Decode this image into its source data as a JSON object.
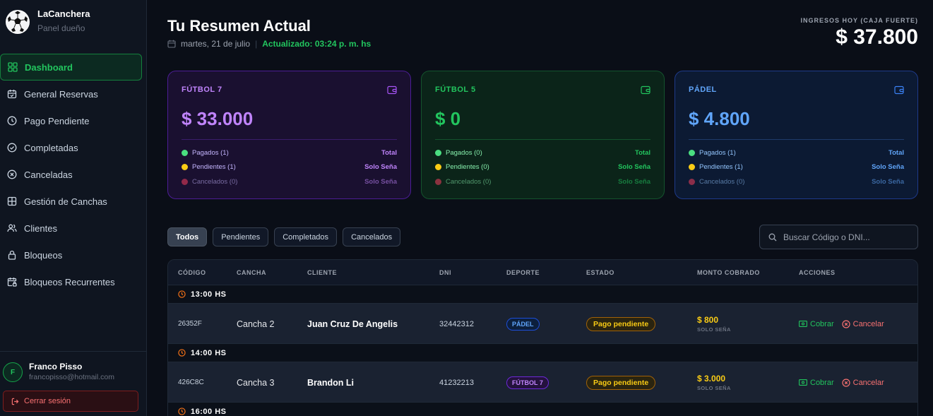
{
  "brand": {
    "name": "LaCanchera",
    "subtitle": "Panel dueño"
  },
  "sidebar": {
    "items": [
      {
        "label": "Dashboard",
        "icon": "grid-icon",
        "active": true
      },
      {
        "label": "General Reservas",
        "icon": "calendar-icon"
      },
      {
        "label": "Pago Pendiente",
        "icon": "clock-icon"
      },
      {
        "label": "Completadas",
        "icon": "check-circle-icon"
      },
      {
        "label": "Canceladas",
        "icon": "x-circle-icon"
      },
      {
        "label": "Gestión de Canchas",
        "icon": "layout-icon"
      },
      {
        "label": "Clientes",
        "icon": "users-icon"
      },
      {
        "label": "Bloqueos",
        "icon": "lock-icon"
      },
      {
        "label": "Bloqueos Recurrentes",
        "icon": "calendar-lock-icon"
      }
    ]
  },
  "user": {
    "initial": "F",
    "name": "Franco Pisso",
    "email": "francopisso@hotmail.com",
    "logout": "Cerrar sesión"
  },
  "header": {
    "title": "Tu Resumen Actual",
    "date": "martes, 21 de julio",
    "updated": "Actualizado: 03:24 p. m. hs",
    "income_label": "INGRESOS HOY (CAJA FUERTE)",
    "income_value": "$ 37.800"
  },
  "cards": [
    {
      "title": "FÚTBOL 7",
      "amount": "$ 33.000",
      "paid": "Pagados (1)",
      "paid_r": "Total",
      "pending": "Pendientes (1)",
      "pending_r": "Solo Seña",
      "cancelled": "Cancelados (0)",
      "cancelled_r": "Solo Seña"
    },
    {
      "title": "FÚTBOL 5",
      "amount": "$ 0",
      "paid": "Pagados (0)",
      "paid_r": "Total",
      "pending": "Pendientes (0)",
      "pending_r": "Solo Seña",
      "cancelled": "Cancelados (0)",
      "cancelled_r": "Solo Seña"
    },
    {
      "title": "PÁDEL",
      "amount": "$ 4.800",
      "paid": "Pagados (1)",
      "paid_r": "Total",
      "pending": "Pendientes (1)",
      "pending_r": "Solo Seña",
      "cancelled": "Cancelados (0)",
      "cancelled_r": "Solo Seña"
    }
  ],
  "filters": {
    "all": "Todos",
    "pending": "Pendientes",
    "completed": "Completados",
    "cancelled": "Cancelados"
  },
  "search": {
    "placeholder": "Buscar Código o DNI..."
  },
  "table": {
    "headers": {
      "code": "CÓDIGO",
      "court": "CANCHA",
      "client": "CLIENTE",
      "dni": "DNI",
      "sport": "DEPORTE",
      "status": "ESTADO",
      "amount": "MONTO COBRADO",
      "actions": "ACCIONES"
    },
    "groups": [
      {
        "time": "13:00 HS",
        "row": {
          "code": "26352F",
          "court": "Cancha 2",
          "client": "Juan Cruz De Angelis",
          "dni": "32442312",
          "sport": "PÁDEL",
          "status": "Pago pendiente",
          "amount": "$ 800",
          "amount_note": "SOLO SEÑA",
          "charge": "Cobrar",
          "cancel": "Cancelar"
        }
      },
      {
        "time": "14:00 HS",
        "row": {
          "code": "426C8C",
          "court": "Cancha 3",
          "client": "Brandon Li",
          "dni": "41232213",
          "sport": "FÚTBOL 7",
          "status": "Pago pendiente",
          "amount": "$ 3.000",
          "amount_note": "SOLO SEÑA",
          "charge": "Cobrar",
          "cancel": "Cancelar"
        }
      },
      {
        "time": "16:00 HS"
      }
    ]
  },
  "colors": {
    "accent": "#22c55e",
    "futbol7": "#c084fc",
    "futbol5": "#22c55e",
    "padel": "#60a5fa",
    "pending": "#facc15",
    "danger": "#f87171"
  }
}
